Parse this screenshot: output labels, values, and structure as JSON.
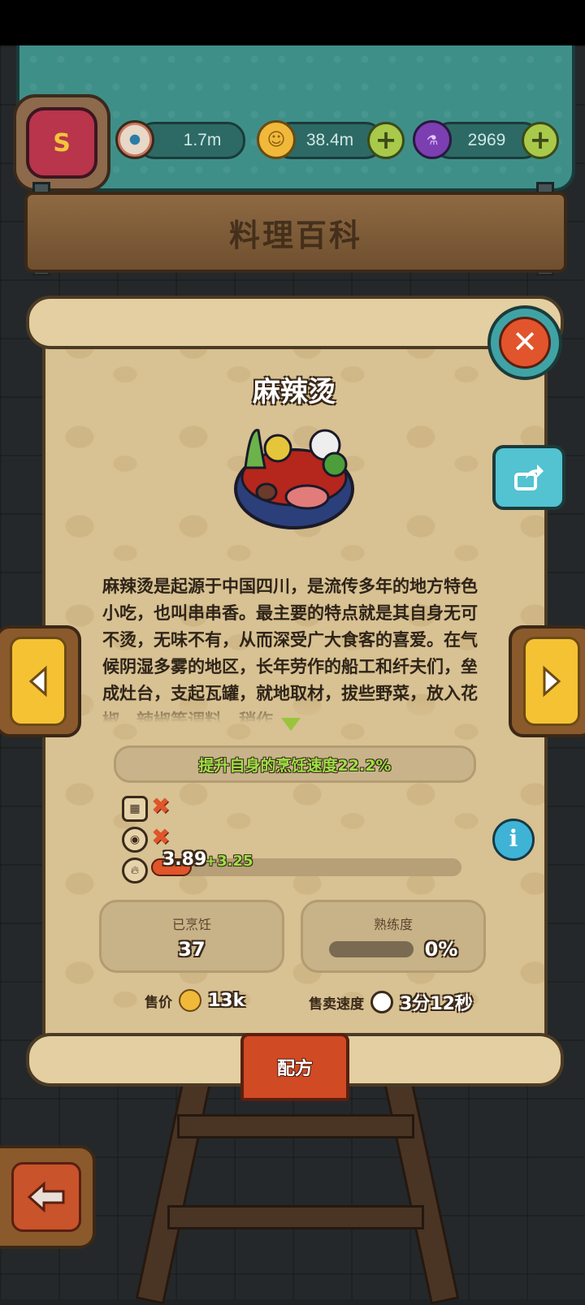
{
  "header": {
    "eyes_value": "1.7m",
    "coins_value": "38.4m",
    "potions_value": "2969",
    "icons": [
      "eye-icon",
      "coin-icon",
      "potion-icon",
      "plus-icon"
    ],
    "avatar_letter": "S"
  },
  "page_title": "料理百科",
  "dish": {
    "name": "麻辣烫",
    "description": "麻辣烫是起源于中国四川，是流传多年的地方特色小吃，也叫串串香。最主要的特点就是其自身无可不烫，无味不有，从而深受广大食客的喜爱。在气候阴湿多雾的地区，长年劳作的船工和纤夫们，垒成灶台，支起瓦罐，就地取材，拔些野菜，放入花椒，辣椒等调料，稍作",
    "effect": "提升自身的烹饪速度22.2%",
    "speed_value": "3.89",
    "speed_bonus": "+3.25",
    "speed_fill_fraction": 0.13,
    "cooked_label": "已烹饪",
    "cooked_value": "37",
    "mastery_label": "熟练度",
    "mastery_value": "0%",
    "mastery_fraction": 0,
    "price_label": "售价",
    "price_value": "13k",
    "sell_speed_label": "售卖速度",
    "sell_speed_value": "3分12秒"
  },
  "recipe_tab_label": "配方",
  "colors": {
    "accent_green": "#9fe047",
    "accent_orange": "#e0552a",
    "parchment": "#d8c192",
    "teal": "#3f8f89"
  }
}
